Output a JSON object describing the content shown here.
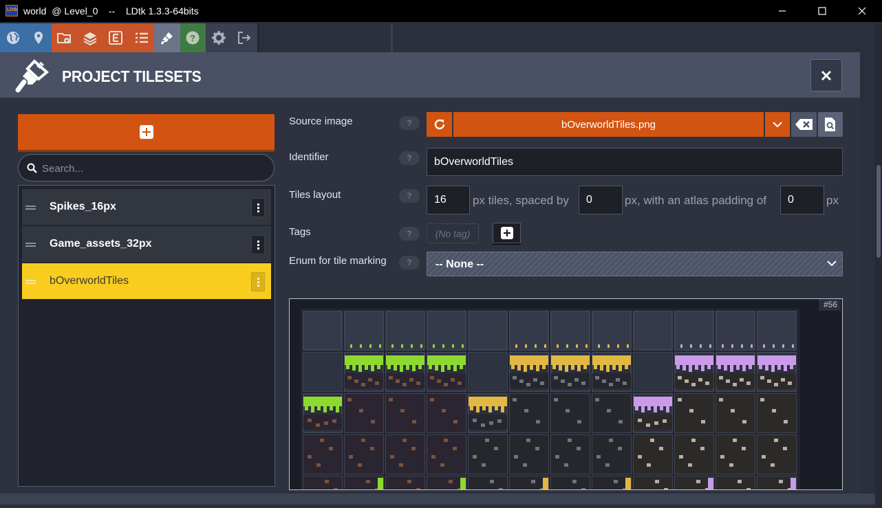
{
  "titlebar": {
    "title": "world  @ Level_0    --    LDtk 1.3.3-64bits",
    "minimize_icon": "minimize-icon",
    "maximize_icon": "maximize-icon",
    "close_icon": "close-icon"
  },
  "toolbar": {
    "buttons": [
      {
        "icon": "globe-icon",
        "color": "#3b6fa6"
      },
      {
        "icon": "map-pin-icon",
        "color": "#3b6fa6"
      },
      {
        "icon": "folder-gear-icon",
        "color": "#c9542a"
      },
      {
        "icon": "layers-icon",
        "color": "#c9542a"
      },
      {
        "icon": "entity-icon",
        "color": "#c9542a"
      },
      {
        "icon": "list-icon",
        "color": "#c9542a"
      },
      {
        "icon": "brush-icon",
        "color": "#6b7488"
      },
      {
        "icon": "help-icon",
        "color": "#3f7a43"
      },
      {
        "icon": "settings-icon",
        "color": "#3b4050"
      },
      {
        "icon": "exit-icon",
        "color": "#3b4050"
      }
    ]
  },
  "panel": {
    "title": "PROJECT TILESETS",
    "icon": "brush-icon"
  },
  "sidebar": {
    "search_placeholder": "Search...",
    "tilesets": [
      {
        "label": "Spikes_16px",
        "selected": false
      },
      {
        "label": "Game_assets_32px",
        "selected": false
      },
      {
        "label": "bOverworldTiles",
        "selected": true
      }
    ]
  },
  "form": {
    "source_label": "Source image",
    "source_file": "bOverworldTiles.png",
    "identifier_label": "Identifier",
    "identifier_value": "bOverworldTiles",
    "layout_label": "Tiles layout",
    "tile_size": "16",
    "layout_text_1": "px tiles, spaced by",
    "spacing": "0",
    "layout_text_2": "px, with an atlas padding of",
    "padding": "0",
    "layout_text_3": "px",
    "tags_label": "Tags",
    "no_tag": "(No tag)",
    "enum_label": "Enum for tile marking",
    "enum_value": "-- None --",
    "help_text": "?"
  },
  "preview": {
    "tile_badge": "#56",
    "colors": {
      "grass": "#8ed92f",
      "sand": "#e2b844",
      "purple": "#c99be8",
      "dirt_brown": "#7a5240",
      "stone_gray": "#6a7680",
      "stone_light": "#b7adaa"
    }
  },
  "colors": {
    "accent_orange": "#d35411",
    "selected_yellow": "#f8cd1f"
  }
}
